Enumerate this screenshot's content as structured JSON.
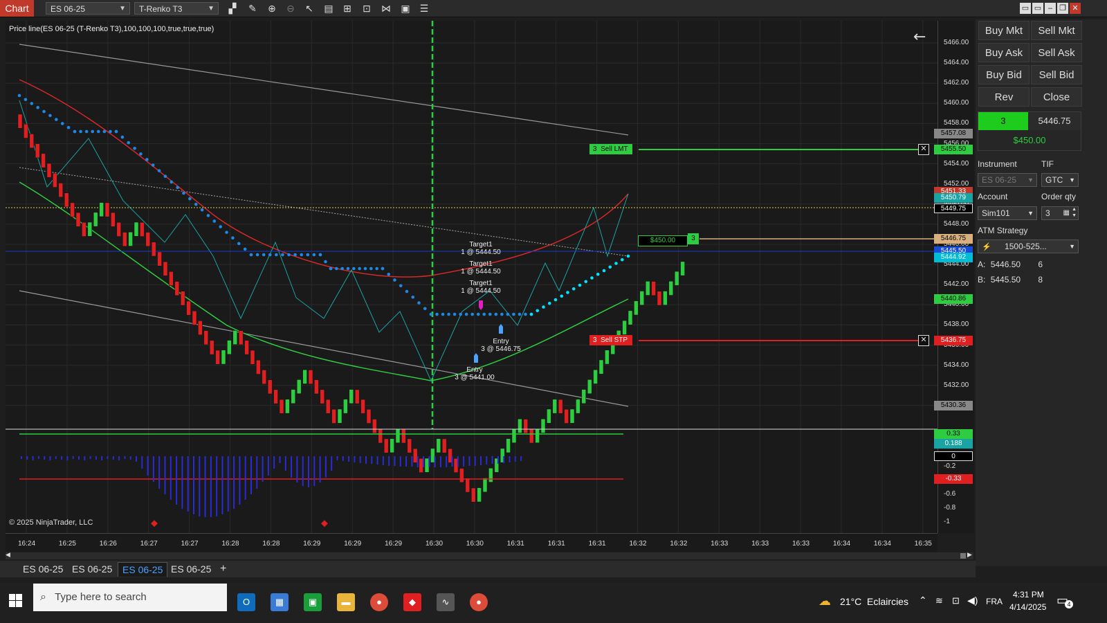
{
  "toolbar": {
    "chart_tab": "Chart",
    "instrument": "ES 06-25",
    "bar_type": "T-Renko T3"
  },
  "chart": {
    "indicator_label": "Price line(ES 06-25 (T-Renko T3),100,100,100,true,true,true)",
    "copyright": "© 2025 NinjaTrader, LLC",
    "price_ticks": [
      "5466.00",
      "5464.00",
      "5462.00",
      "5460.00",
      "5458.00",
      "5456.00",
      "5454.00",
      "5452.00",
      "5450.00",
      "5448.00",
      "5446.00",
      "5444.00",
      "5442.00",
      "5440.00",
      "5438.00",
      "5436.00",
      "5434.00",
      "5432.00",
      "5430.00"
    ],
    "price_tags": [
      {
        "text": "5457.08",
        "color": "#888888"
      },
      {
        "text": "5455.50",
        "color": "#2ecc40"
      },
      {
        "text": "5451.33",
        "color": "#c0392b"
      },
      {
        "text": "5450.79",
        "color": "#1aa3a3"
      },
      {
        "text": "5449.75",
        "color": "#000000"
      },
      {
        "text": "5446.75",
        "color": "#d8b080"
      },
      {
        "text": "5445.50",
        "color": "#1a4ad8"
      },
      {
        "text": "5444.92",
        "color": "#00bcd4"
      },
      {
        "text": "5440.86",
        "color": "#2ecc40"
      },
      {
        "text": "5436.75",
        "color": "#e02020"
      },
      {
        "text": "5430.36",
        "color": "#888888"
      }
    ],
    "osc_tags": [
      {
        "text": "0.33",
        "color": "#2ecc40"
      },
      {
        "text": "0.188",
        "color": "#1aa3a3"
      },
      {
        "text": "0",
        "color": "#000000"
      },
      {
        "text": "-0.33",
        "color": "#e02020"
      }
    ],
    "osc_ticks": [
      "-0.2",
      "-0.4",
      "-0.6",
      "-0.8",
      "-1"
    ],
    "time_ticks": [
      "16:24",
      "16:25",
      "16:26",
      "16:27",
      "16:27",
      "16:28",
      "16:28",
      "16:29",
      "16:29",
      "16:29",
      "16:30",
      "16:30",
      "16:31",
      "16:31",
      "16:31",
      "16:32",
      "16:32",
      "16:33",
      "16:33",
      "16:33",
      "16:34",
      "16:34",
      "16:35"
    ],
    "orders": {
      "sell_lmt": {
        "qty": "3",
        "label": "Sell LMT"
      },
      "sell_stp": {
        "qty": "3",
        "label": "Sell STP"
      },
      "position": {
        "pnl": "$450.00",
        "qty": "3"
      }
    },
    "annotations": [
      {
        "title": "Target1",
        "detail": "1 @ 5444.50"
      },
      {
        "title": "Target1",
        "detail": "1 @ 5444.50"
      },
      {
        "title": "Target1",
        "detail": "1 @ 5444.50"
      },
      {
        "title": "Entry",
        "detail": "3 @ 5446.75"
      },
      {
        "title": "Entry",
        "detail": "3 @ 5441.00"
      }
    ]
  },
  "right_panel": {
    "buttons": [
      "Buy Mkt",
      "Sell Mkt",
      "Buy Ask",
      "Sell Ask",
      "Buy Bid",
      "Sell Bid",
      "Rev",
      "Close"
    ],
    "position_qty": "3",
    "position_price": "5446.75",
    "position_pnl": "$450.00",
    "instrument_label": "Instrument",
    "instrument_value": "ES 06-25",
    "tif_label": "TIF",
    "tif_value": "GTC",
    "account_label": "Account",
    "account_value": "Sim101",
    "order_qty_label": "Order qty",
    "order_qty_value": "3",
    "atm_label": "ATM Strategy",
    "atm_value": "1500-525...",
    "ask_label": "A:",
    "ask_price": "5446.50",
    "ask_size": "6",
    "bid_label": "B:",
    "bid_price": "5445.50",
    "bid_size": "8"
  },
  "bottom_tabs": [
    "ES 06-25",
    "ES 06-25",
    "ES 06-25",
    "ES 06-25"
  ],
  "taskbar": {
    "search_placeholder": "Type here to search",
    "weather": "21°C  Eclaircies",
    "lang": "FRA",
    "time": "4:31 PM",
    "date": "4/14/2025",
    "notif_count": "4"
  }
}
